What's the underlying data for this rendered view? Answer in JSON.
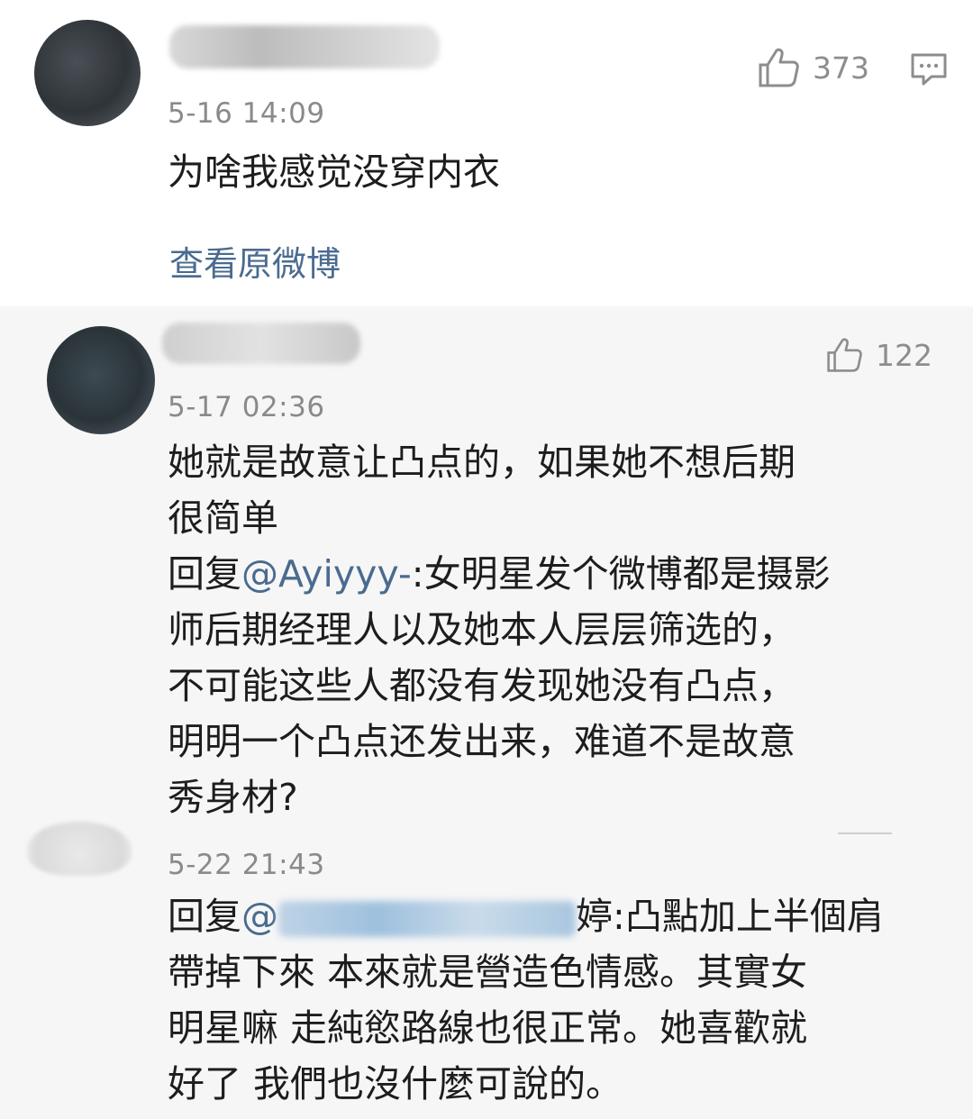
{
  "comments": [
    {
      "timestamp": "5-16 14:09",
      "likes": "373",
      "text": "为啥我感觉没穿内衣",
      "view_original": "查看原微博"
    },
    {
      "timestamp": "5-17 02:36",
      "likes": "122",
      "lines": [
        "她就是故意让凸点的，如果她不想后期",
        "很简单"
      ],
      "reply_prefix": "回复",
      "reply_mention": "@Ayiyyy-",
      "reply_lines": [
        ":女明星发个微博都是摄影",
        "师后期经理人以及她本人层层筛选的，",
        "不可能这些人都没有发现她没有凸点，",
        "明明一个凸点还发出来，难道不是故意",
        "秀身材?"
      ]
    },
    {
      "timestamp": "5-22 21:43",
      "reply_prefix": "回复",
      "reply_mention": "@",
      "reply_lines": [
        "婷:凸點加上半個肩",
        "帶掉下來 本來就是營造色情感。其實女",
        "明星嘛 走純慾路線也很正常。她喜歡就",
        "好了 我們也沒什麼可說的。"
      ]
    }
  ],
  "icons": {
    "like": "thumbs-up-icon",
    "reply": "comment-icon"
  },
  "colors": {
    "link": "#4a6b8f",
    "meta": "#8a8a8a",
    "text": "#1d1d1d"
  }
}
